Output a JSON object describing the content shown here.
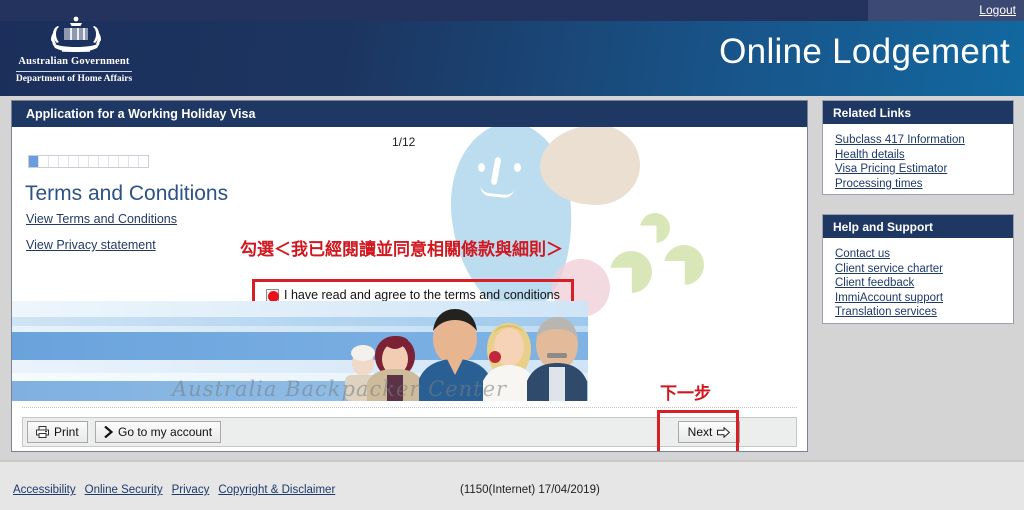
{
  "header": {
    "logout_label": "Logout",
    "crest_line1": "Australian Government",
    "crest_line2": "Department of Home Affairs",
    "app_title": "Online Lodgement",
    "colors": {
      "dark_navy": "#1c2f5c",
      "teal_blue": "#1268a0",
      "topbar": "#24335e"
    }
  },
  "main": {
    "panel_title": "Application for a Working Holiday Visa",
    "page_counter": "1/12",
    "progress": {
      "total_segments": 12,
      "filled_segments": 1,
      "fill_color": "#6a9de0"
    },
    "section_heading": "Terms and Conditions",
    "link_terms": "View Terms and Conditions",
    "link_privacy": "View Privacy statement",
    "checkbox": {
      "label": "I have read and agree to the terms and conditions",
      "checked": true,
      "marker_color": "#e8111a"
    },
    "banner_watermark": "Australia Backpacker Center"
  },
  "annotations": {
    "checkbox_note": "勾選＜我已經閱讀並同意相關條款與細則＞",
    "next_note": "下一步",
    "highlight_color": "#d81f26"
  },
  "buttons": {
    "print": "Print",
    "print_icon": "printer-icon",
    "go_to_account": "Go to my account",
    "go_to_account_icon": "chevron-right-icon",
    "next": "Next",
    "next_icon": "arrow-right-icon"
  },
  "sidebar": {
    "related": {
      "title": "Related Links",
      "links": [
        "Subclass 417 Information",
        "Health details",
        "Visa Pricing Estimator",
        "Processing times"
      ]
    },
    "help": {
      "title": "Help and Support",
      "links": [
        "Contact us",
        "Client service charter",
        "Client feedback",
        "ImmiAccount support",
        "Translation services"
      ]
    }
  },
  "footer": {
    "links": [
      "Accessibility",
      "Online Security",
      "Privacy",
      "Copyright & Disclaimer"
    ],
    "version": "(1150(Internet) 17/04/2019)"
  }
}
